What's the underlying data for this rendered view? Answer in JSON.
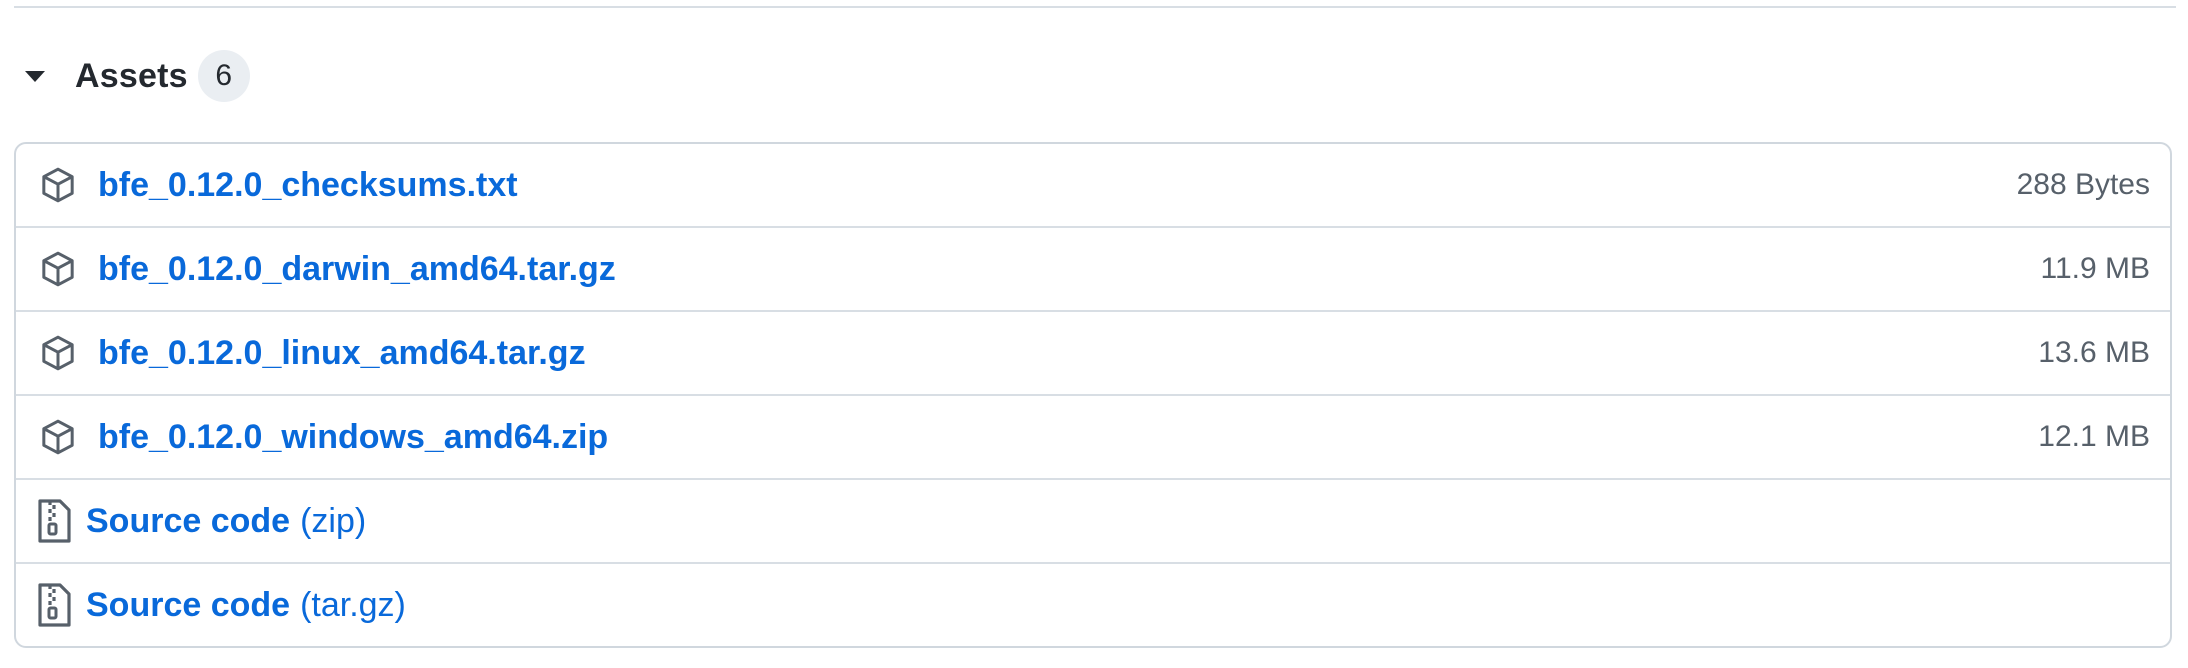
{
  "assets": {
    "title": "Assets",
    "count": "6",
    "items": [
      {
        "name": "bfe_0.12.0_checksums.txt",
        "size": "288 Bytes"
      },
      {
        "name": "bfe_0.12.0_darwin_amd64.tar.gz",
        "size": "11.9 MB"
      },
      {
        "name": "bfe_0.12.0_linux_amd64.tar.gz",
        "size": "13.6 MB"
      },
      {
        "name": "bfe_0.12.0_windows_amd64.zip",
        "size": "12.1 MB"
      }
    ],
    "source": [
      {
        "label": "Source code",
        "format": "(zip)"
      },
      {
        "label": "Source code",
        "format": "(tar.gz)"
      }
    ]
  },
  "colors": {
    "link": "#0969da",
    "text": "#24292f",
    "muted": "#57606a",
    "border": "#d0d7de",
    "badge_bg": "#eaeef2"
  },
  "icons": {
    "collapse": "triangle-down-icon",
    "asset": "package-icon",
    "source": "file-zip-icon"
  }
}
